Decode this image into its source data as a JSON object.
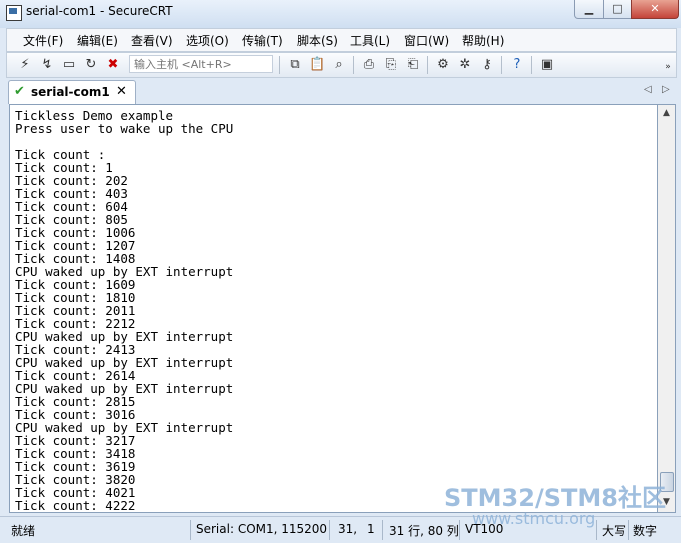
{
  "window": {
    "title": "serial-com1 - SecureCRT"
  },
  "menu": [
    "文件(F)",
    "编辑(E)",
    "查看(V)",
    "选项(O)",
    "传输(T)",
    "脚本(S)",
    "工具(L)",
    "窗口(W)",
    "帮助(H)"
  ],
  "toolbar": {
    "host_placeholder": "输入主机 <Alt+R>"
  },
  "tab": {
    "label": "serial-com1"
  },
  "terminal": {
    "lines": [
      "Tickless Demo example",
      "Press user to wake up the CPU",
      "",
      "Tick count :",
      "Tick count: 1",
      "Tick count: 202",
      "Tick count: 403",
      "Tick count: 604",
      "Tick count: 805",
      "Tick count: 1006",
      "Tick count: 1207",
      "Tick count: 1408",
      "CPU waked up by EXT interrupt",
      "Tick count: 1609",
      "Tick count: 1810",
      "Tick count: 2011",
      "Tick count: 2212",
      "CPU waked up by EXT interrupt",
      "Tick count: 2413",
      "CPU waked up by EXT interrupt",
      "Tick count: 2614",
      "CPU waked up by EXT interrupt",
      "Tick count: 2815",
      "Tick count: 3016",
      "CPU waked up by EXT interrupt",
      "Tick count: 3217",
      "Tick count: 3418",
      "Tick count: 3619",
      "Tick count: 3820",
      "Tick count: 4021",
      "Tick count: 4222"
    ]
  },
  "status": {
    "ready": "就绪",
    "connection": "Serial: COM1, 115200",
    "row": "31,",
    "col": "1",
    "position": "31 行, 80 列",
    "emulation": "VT100",
    "caps": "大写",
    "num": "数字"
  },
  "watermark": {
    "line1": "STM32/STM8社区",
    "line2": "www.stmcu.org"
  }
}
